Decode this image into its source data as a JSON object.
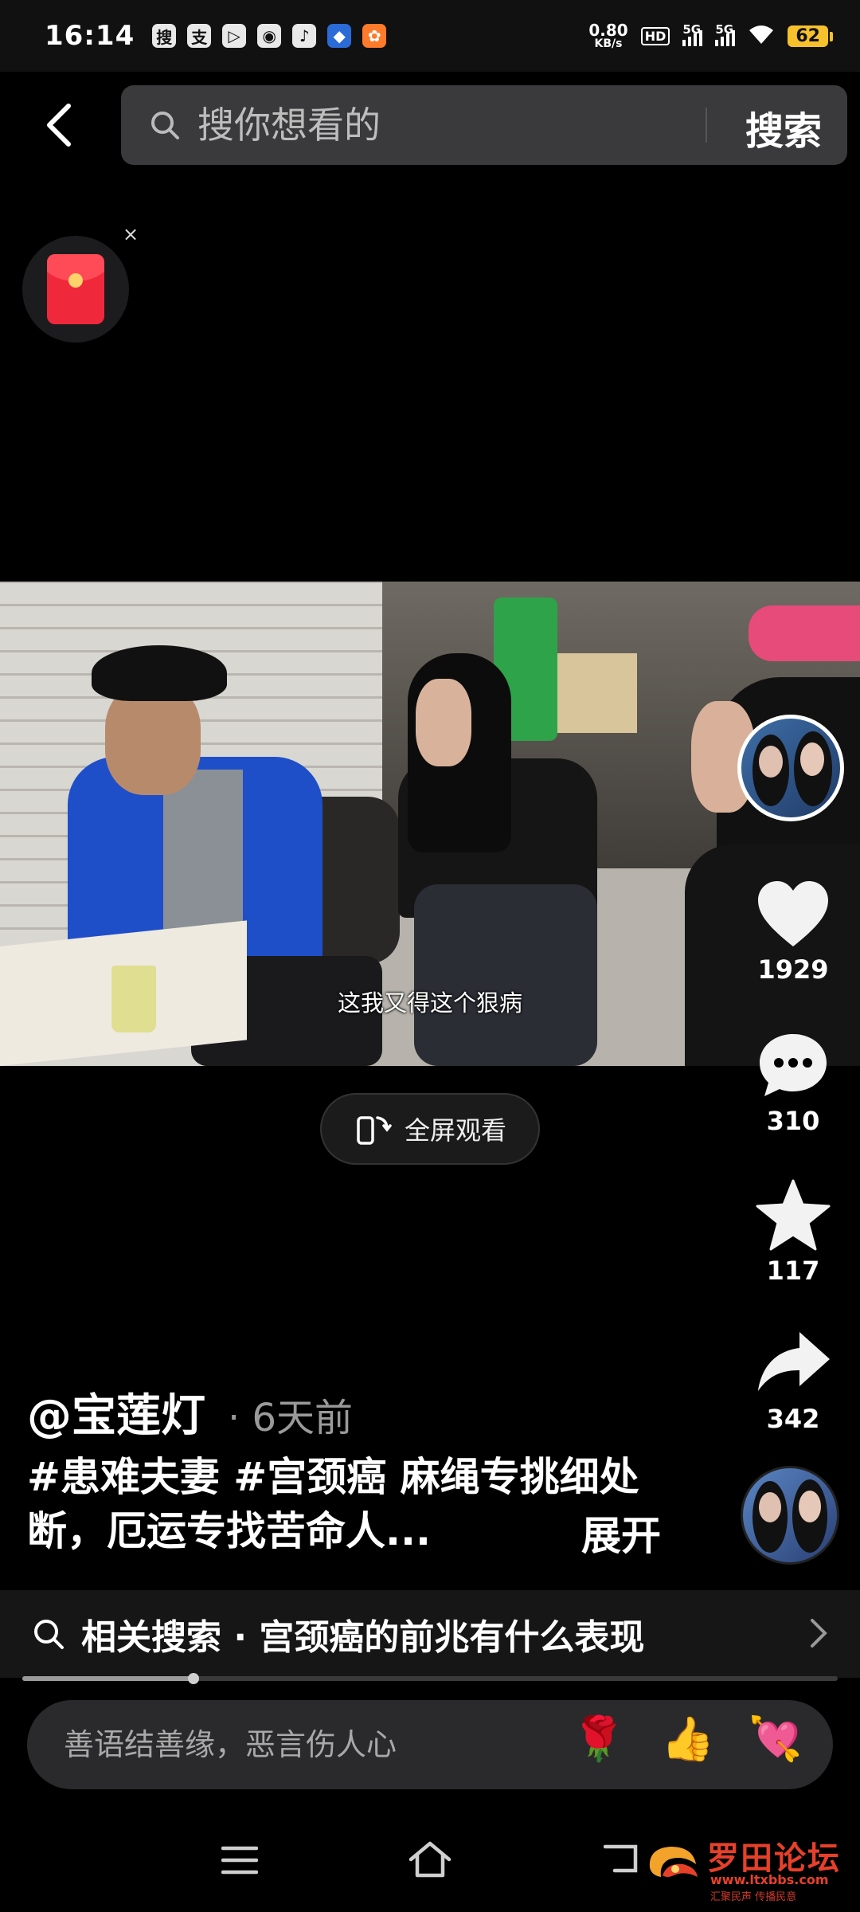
{
  "status_bar": {
    "time": "16:14",
    "apps": [
      "搜",
      "支",
      "▷",
      "◉",
      "♪",
      "◆",
      "✿"
    ],
    "net_speed_value": "0.80",
    "net_speed_unit": "KB/s",
    "hd_label": "HD",
    "sim1": "5G",
    "sim2": "5G",
    "battery": "62"
  },
  "header": {
    "search_placeholder": "搜你想看的",
    "search_button": "搜索"
  },
  "video": {
    "subtitle": "这我又得这个狠病",
    "fullscreen_label": "全屏观看"
  },
  "actions": {
    "likes": "1929",
    "comments": "310",
    "favorites": "117",
    "shares": "342"
  },
  "post": {
    "author": "@宝莲灯",
    "time": "· 6天前",
    "caption": "#患难夫妻 #宫颈癌 麻绳专挑细处断，厄运专找苦命人...",
    "expand": "展开"
  },
  "related_search": {
    "text": "相关搜索 · 宫颈癌的前兆有什么表现"
  },
  "playback": {
    "progress": 0.21
  },
  "comment_bar": {
    "placeholder": "善语结善缘，恶言伤人心",
    "emojis": [
      "🌹",
      "👍",
      "💘"
    ]
  },
  "watermark": {
    "title": "罗田论坛",
    "url": "www.ltxbbs.com",
    "slogan": "汇聚民声  传播民意"
  },
  "colors": {
    "background": "#000000",
    "search_bg": "#3a3a3c",
    "battery": "#f6c12c",
    "watermark_red": "#e6402a"
  }
}
